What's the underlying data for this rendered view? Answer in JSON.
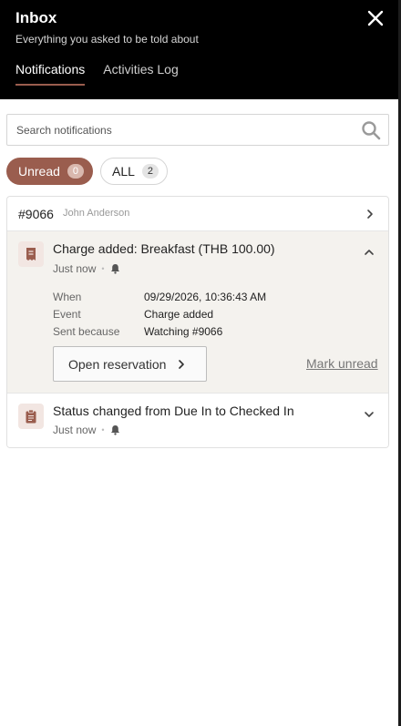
{
  "header": {
    "title": "Inbox",
    "subtitle": "Everything you asked to be told about",
    "tabs": [
      {
        "label": "Notifications",
        "active": true
      },
      {
        "label": "Activities Log",
        "active": false
      }
    ],
    "close_icon": "close-icon"
  },
  "search": {
    "placeholder": "Search notifications",
    "value": "",
    "icon": "search-icon"
  },
  "filters": {
    "unread": {
      "label": "Unread",
      "count": "0",
      "active": true
    },
    "all": {
      "label": "ALL",
      "count": "2",
      "active": false
    }
  },
  "group": {
    "reservation": "#9066",
    "guest": "John Anderson",
    "notifications": [
      {
        "title": "Charge added: Breakfast (THB 100.00)",
        "time": "Just now",
        "icon": "receipt-icon",
        "expanded": true,
        "details": [
          {
            "label": "When",
            "value": "09/29/2026, 10:36:43 AM"
          },
          {
            "label": "Event",
            "value": "Charge added"
          },
          {
            "label": "Sent because",
            "value": "Watching #9066"
          }
        ],
        "open_label": "Open reservation",
        "mark_label": "Mark unread"
      },
      {
        "title": "Status changed from Due In to Checked In",
        "time": "Just now",
        "icon": "clipboard-icon",
        "expanded": false
      }
    ]
  },
  "colors": {
    "header_bg": "#000000",
    "accent": "#9a5d4e",
    "expanded_bg": "#f4f2ee"
  }
}
